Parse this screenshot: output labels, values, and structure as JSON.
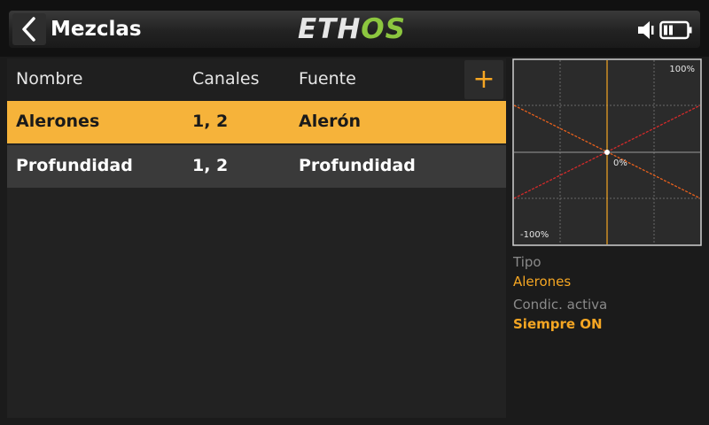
{
  "header": {
    "title": "Mezclas",
    "logo_part1": "ETH",
    "logo_part2": "OS"
  },
  "table": {
    "columns": [
      "Nombre",
      "Canales",
      "Fuente"
    ],
    "add_label": "+",
    "rows": [
      {
        "nombre": "Alerones",
        "canales": "1, 2",
        "fuente": "Alerón",
        "selected": true
      },
      {
        "nombre": "Profundidad",
        "canales": "1, 2",
        "fuente": "Profundidad",
        "selected": false
      }
    ]
  },
  "graph": {
    "top_label": "100%",
    "center_label": "0%",
    "bottom_label": "-100%",
    "series_colors": [
      "#e8601c",
      "#d42a2a"
    ]
  },
  "info": {
    "tipo_label": "Tipo",
    "tipo_value": "Alerones",
    "condicion_label": "Condic. activa",
    "condicion_value": "Siempre ON"
  },
  "colors": {
    "accent": "#f6b33a",
    "logo_green": "#8cc63f"
  }
}
